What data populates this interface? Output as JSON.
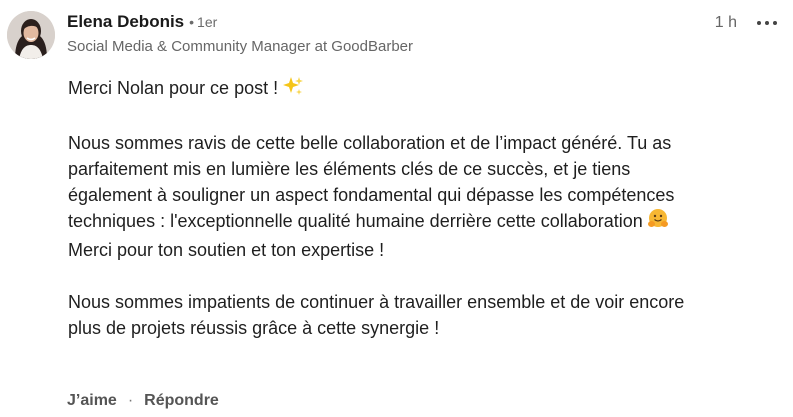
{
  "comment": {
    "author": {
      "name": "Elena Debonis",
      "separator": "•",
      "degree": "1er",
      "headline": "Social Media & Community Manager at GoodBarber"
    },
    "timestamp": "1 h",
    "more_icon": "ellipsis-horizontal-icon",
    "paragraphs": [
      {
        "text": "Merci Nolan pour ce post !",
        "emoji": "sparkles-icon"
      },
      {
        "lines": [
          "Nous sommes ravis de cette belle collaboration et de l’impact généré. Tu as",
          "parfaitement mis en lumière les éléments clés de ce succès, et je tiens",
          "également à souligner un aspect fondamental qui dépasse les compétences",
          "techniques : l'exceptionnelle qualité humaine derrière cette collaboration",
          "Merci pour ton soutien et ton expertise !"
        ],
        "emoji": "hugging-face-icon"
      },
      {
        "lines": [
          "Nous sommes impatients de continuer à travailler ensemble et de voir encore",
          "plus de projets réussis grâce à cette synergie !"
        ]
      }
    ],
    "actions": {
      "like_label": "J’aime",
      "separator": "·",
      "reply_label": "Répondre"
    }
  }
}
